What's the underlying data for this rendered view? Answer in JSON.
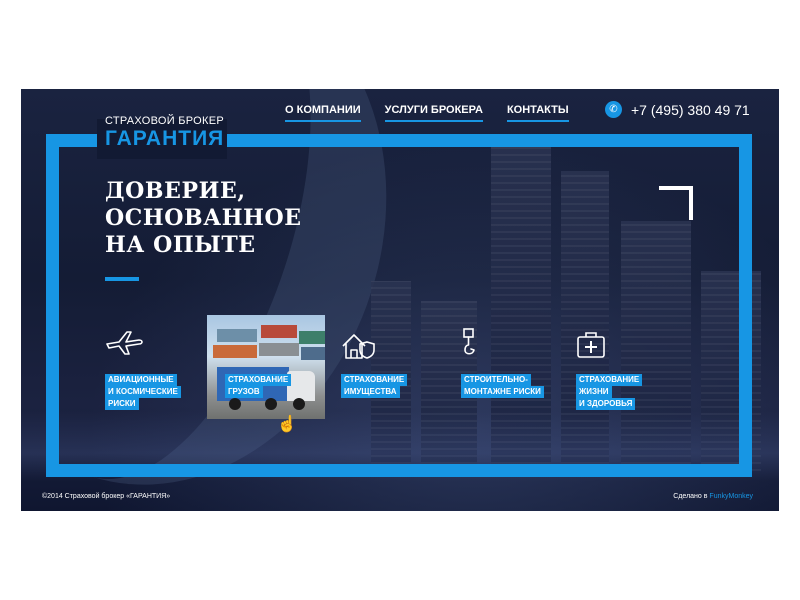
{
  "brand": {
    "tagline": "СТРАХОВОЙ БРОКЕР",
    "name": "ГАРАНТИЯ",
    "accent_color": "#1796e4",
    "background_color": "#121a33"
  },
  "nav": {
    "items": [
      {
        "label": "О КОМПАНИИ"
      },
      {
        "label": "УСЛУГИ БРОКЕРА"
      },
      {
        "label": "КОНТАКТЫ"
      }
    ]
  },
  "contact": {
    "icon": "phone-icon",
    "phone": "+7 (495) 380 49 71"
  },
  "hero": {
    "headline_lines": [
      "ДОВЕРИЕ,",
      "ОСНОВАННОЕ",
      "НА ОПЫТЕ"
    ]
  },
  "services": [
    {
      "icon": "airplane-icon",
      "lines": [
        "АВИАЦИОННЫЕ",
        "И КОСМИЧЕСКИЕ",
        "РИСКИ"
      ]
    },
    {
      "icon": "truck-photo",
      "lines": [
        "СТРАХОВАНИЕ",
        "ГРУЗОВ"
      ],
      "hovered": true
    },
    {
      "icon": "house-shield-icon",
      "lines": [
        "СТРАХОВАНИЕ",
        "ИМУЩЕСТВА"
      ]
    },
    {
      "icon": "crane-hook-icon",
      "lines": [
        "СТРОИТЕЛЬНО-",
        "МОНТАЖНЕ РИСКИ"
      ]
    },
    {
      "icon": "medical-case-icon",
      "lines": [
        "СТРАХОВАНИЕ",
        "ЖИЗНИ",
        "И ЗДОРОВЬЯ"
      ]
    }
  ],
  "footer": {
    "copyright": "©2014 Страховой брокер «ГАРАНТИЯ»",
    "made_by_prefix": "Сделано в ",
    "made_by_brand": "FunkyMonkey"
  }
}
